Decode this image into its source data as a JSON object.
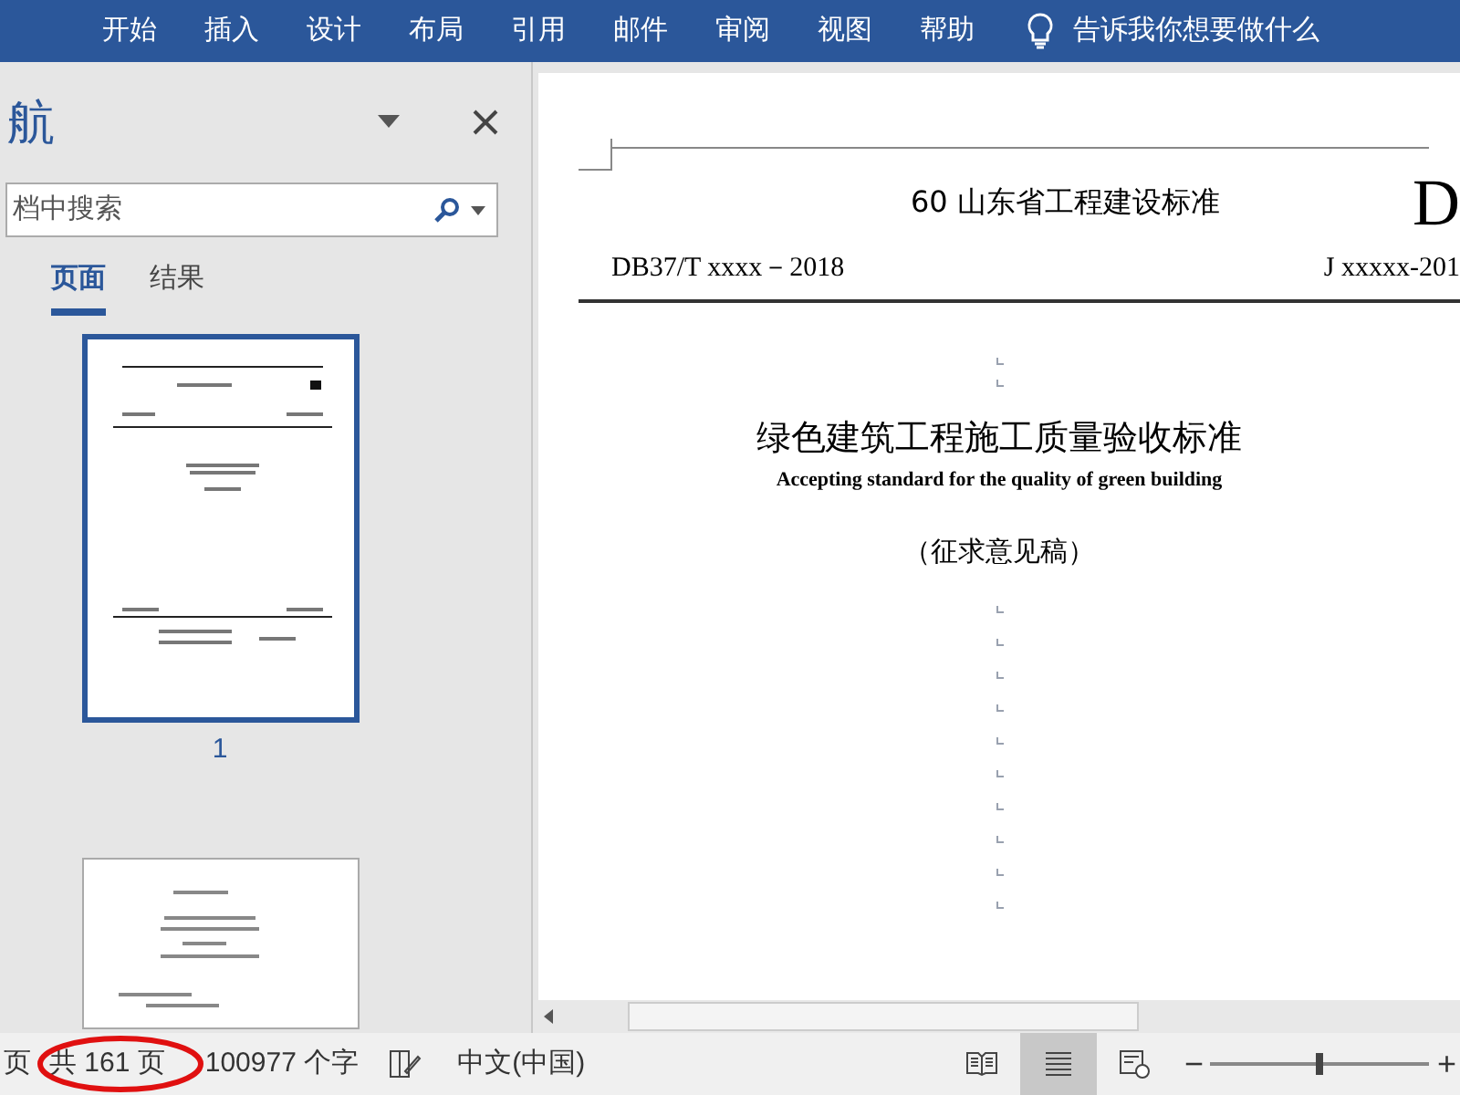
{
  "ribbon": {
    "tabs": [
      {
        "label": "开始",
        "selected": false
      },
      {
        "label": "插入",
        "selected": false
      },
      {
        "label": "设计",
        "selected": false
      },
      {
        "label": "布局",
        "selected": false
      },
      {
        "label": "引用",
        "selected": false
      },
      {
        "label": "邮件",
        "selected": false
      },
      {
        "label": "审阅",
        "selected": false
      },
      {
        "label": "视图",
        "selected": false
      },
      {
        "label": "帮助",
        "selected": false
      }
    ],
    "tell_me": "告诉我你想要做什么"
  },
  "navigation": {
    "title": "航",
    "search": {
      "placeholder": "档中搜索"
    },
    "tabs": [
      {
        "label": "页面",
        "selected": true
      },
      {
        "label": "结果",
        "selected": false
      }
    ],
    "pages": [
      {
        "label": "1",
        "selected": true
      },
      {
        "selected": false
      }
    ]
  },
  "document": {
    "header_title": "60 山东省工程建设标准",
    "header_code": "D",
    "standard_number": "DB37/T xxxx－2018",
    "record_number": "J xxxxx-201",
    "title": "绿色建筑工程施工质量验收标准",
    "subtitle": "Accepting standard for the quality of green building",
    "draft_note": "（征求意见稿）"
  },
  "status_bar": {
    "page": "页",
    "page_count": "共 161 页",
    "word_count": "100977 个字",
    "language": "中文(中国)",
    "views": [
      {
        "kind": "read",
        "selected": false
      },
      {
        "kind": "print",
        "selected": true
      },
      {
        "kind": "web",
        "selected": false
      }
    ],
    "zoom_out": "−",
    "zoom": {
      "level": 0.5
    },
    "zoom_in": "+"
  }
}
